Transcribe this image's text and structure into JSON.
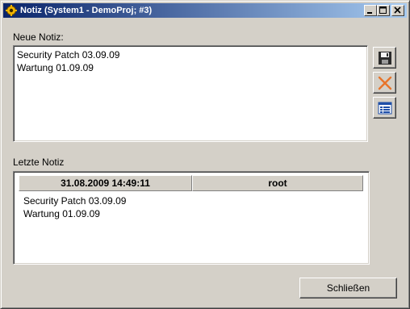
{
  "window": {
    "title": "Notiz (System1 - DemoProj; #3)",
    "caption_buttons": [
      "minimize",
      "maximize",
      "close"
    ]
  },
  "new_note": {
    "label": "Neue Notiz:",
    "lines": [
      "Security Patch 03.09.09",
      "Wartung 01.09.09"
    ]
  },
  "toolbar": {
    "save_icon": "floppy-disk-icon",
    "delete_icon": "orange-x-icon",
    "list_icon": "table-list-icon"
  },
  "last_note": {
    "label": "Letzte Notiz",
    "columns": [
      "31.08.2009 14:49:11",
      "root"
    ],
    "lines": [
      "Security Patch 03.09.09",
      "Wartung 01.09.09"
    ]
  },
  "footer": {
    "close_label": "Schließen"
  },
  "colors": {
    "titlebar_start": "#0a246a",
    "titlebar_end": "#a6caf0",
    "face": "#d4d0c8",
    "delete_x": "#e8742a"
  }
}
